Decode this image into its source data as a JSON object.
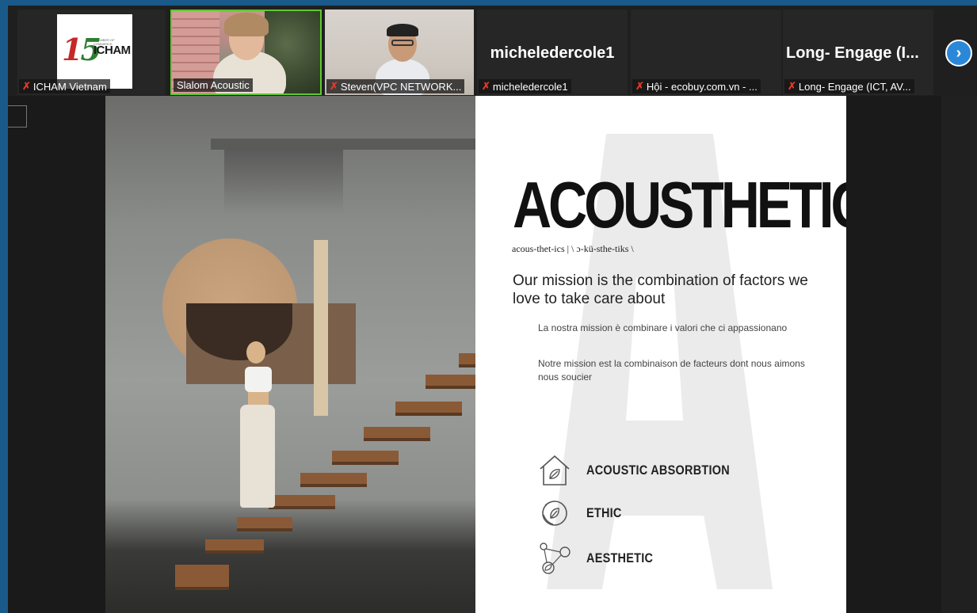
{
  "participants": [
    {
      "name": "ICHAM Vietnam",
      "muted": true
    },
    {
      "name": "Slalom Acoustic",
      "muted": false
    },
    {
      "name": "Steven(VPC NETWORK...",
      "muted": true
    },
    {
      "name": "micheledercole1",
      "muted": true,
      "display": "micheledercole1"
    },
    {
      "name": "Hội - ecobuy.com.vn - ...",
      "muted": true
    },
    {
      "name": "Long- Engage (ICT, AV...",
      "muted": true,
      "display": "Long-  Engage  (I..."
    }
  ],
  "logo": {
    "number": "15",
    "word": "ICHAM"
  },
  "next_icon": "chevron-right-icon",
  "slide": {
    "title": "ACOUSTHETICS",
    "phonetic": "acous-thet-ics | \\ ɔ-kü-sthe-tiks \\",
    "mission": "Our mission is the combination of factors we love to take care about",
    "italian": "La nostra mission è combinare i valori che ci appassionano",
    "french": "Notre mission est la combinaison de facteurs dont nous aimons nous soucier",
    "features": [
      {
        "label": "ACOUSTIC ABSORBTION",
        "icon": "house-leaf-icon"
      },
      {
        "label": "ETHIC",
        "icon": "globe-leaf-icon"
      },
      {
        "label": "AESTHETIC",
        "icon": "molecule-leaf-icon"
      }
    ]
  },
  "colors": {
    "accent": "#2b88d8",
    "active_speaker": "#5ec92f",
    "mute": "#e0392b",
    "frame": "#1a5a8a"
  }
}
